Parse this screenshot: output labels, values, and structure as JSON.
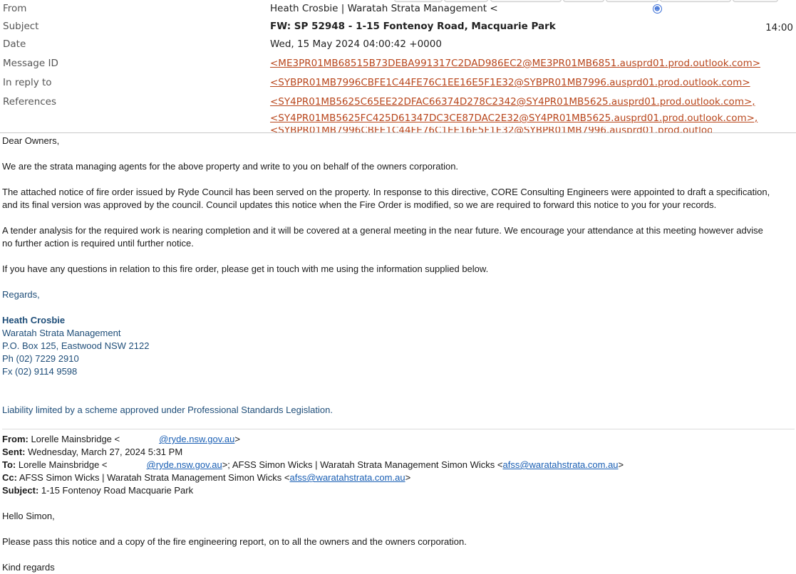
{
  "header": {
    "from_label": "From",
    "from_value": "Heath Crosbie | Waratah Strata Management <",
    "subject_label": "Subject",
    "subject_value": "FW: SP 52948 - 1-15 Fontenoy Road, Macquarie Park",
    "time": "14:00",
    "date_label": "Date",
    "date_value": "Wed, 15 May 2024 04:00:42 +0000",
    "message_id_label": "Message ID",
    "message_id_value": "<ME3PR01MB68515B73DEBA991317C2DAD986EC2@ME3PR01MB6851.ausprd01.prod.outlook.com>",
    "in_reply_to_label": "In reply to",
    "in_reply_to_value": "<SYBPR01MB7996CBFE1C44FE76C1EE16E5F1E32@SYBPR01MB7996.ausprd01.prod.outlook.com>",
    "references_label": "References",
    "references": [
      "<SY4PR01MB5625C65EE22DFAC66374D278C2342@SY4PR01MB5625.ausprd01.prod.outlook.com>,",
      "<SY4PR01MB5625FC425D61347DC3CE87DAC2E32@SY4PR01MB5625.ausprd01.prod.outlook.com>,"
    ]
  },
  "body": {
    "greeting": "Dear Owners,",
    "p1": "We are the strata managing agents for the above property and write to you on behalf of the owners corporation.",
    "p2a": "The attached notice of fire order issued by Ryde Council has been served on the property. In response to this directive, CORE Consulting Engineers were appointed to draft a specification,",
    "p2b": "and its final version was approved by the council. Council updates this notice when the Fire Order is modified, so we are required to forward this notice to you for your records.",
    "p3a": "A tender analysis for the required work is nearing completion and it will be covered at a general meeting in the near future. We encourage your attendance at this meeting however advise",
    "p3b": "no further action is required until further notice.",
    "p4": "If you have any questions in relation to this fire order, please get in touch with me using the information supplied below.",
    "regards": "Regards,",
    "sig_name": "Heath Crosbie",
    "sig_company": "Waratah Strata Management",
    "sig_address": "P.O. Box 125, Eastwood NSW 2122",
    "sig_phone": "Ph (02) 7229 2910",
    "sig_fax": "Fx (02) 9114 9598",
    "liability": "Liability limited by a scheme approved under Professional Standards Legislation."
  },
  "forwarded": {
    "from_label": "From:",
    "from_name": " Lorelle Mainsbridge <",
    "from_email": "@ryde.nsw.gov.au",
    "from_close": ">",
    "sent_label": "Sent:",
    "sent_value": " Wednesday, March 27, 2024 5:31 PM",
    "to_label": "To:",
    "to_name": " Lorelle Mainsbridge <",
    "to_email": "@ryde.nsw.gov.au",
    "to_rest": ">; AFSS Simon Wicks | Waratah Strata Management Simon Wicks <",
    "to_email2": "afss@waratahstrata.com.au",
    "to_close": ">",
    "cc_label": "Cc:",
    "cc_name": " AFSS Simon Wicks | Waratah Strata Management Simon Wicks <",
    "cc_email": "afss@waratahstrata.com.au",
    "cc_close": ">",
    "subject_label": "Subject:",
    "subject_value": " 1-15 Fontenoy Road Macquarie Park",
    "hello": "Hello Simon,",
    "p1": "Please pass this notice and a copy of the fire engineering report,  on to all the owners and the owners corporation.",
    "closing": "Kind regards"
  }
}
